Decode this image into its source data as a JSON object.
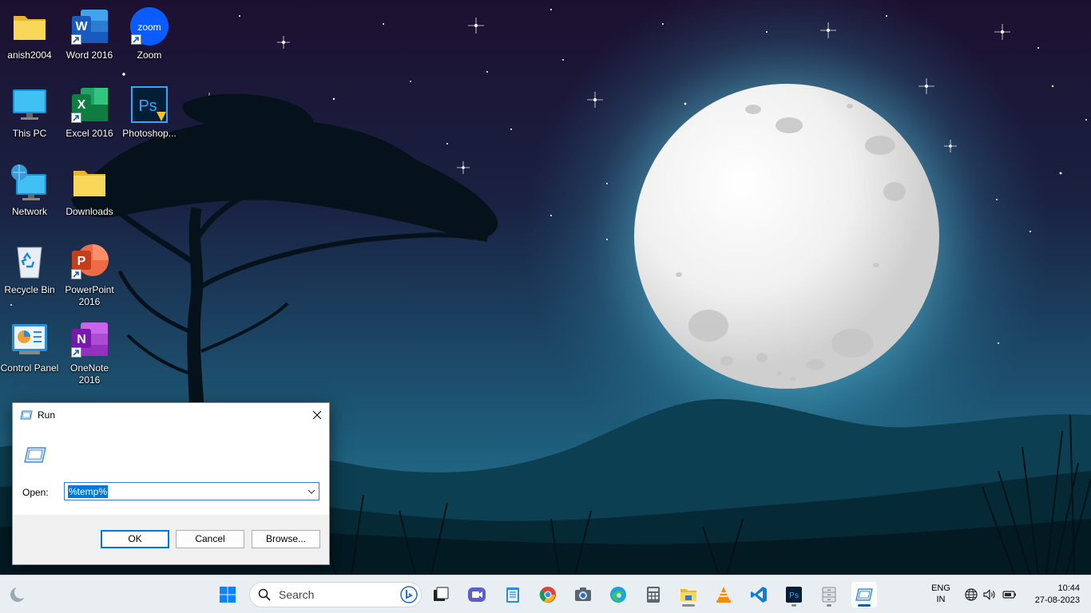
{
  "desktop": {
    "icons": [
      {
        "label": "anish2004"
      },
      {
        "label": "Word 2016"
      },
      {
        "label": "Zoom",
        "brand_text": "zoom"
      },
      {
        "label": "This PC"
      },
      {
        "label": "Excel 2016"
      },
      {
        "label": "Photoshop..."
      },
      {
        "label": "Network"
      },
      {
        "label": "Downloads"
      },
      {
        "label": "Recycle Bin"
      },
      {
        "label": "PowerPoint 2016"
      },
      {
        "label": "Control Panel"
      },
      {
        "label": "OneNote 2016"
      }
    ]
  },
  "run_dialog": {
    "title": "Run",
    "description": "",
    "open_label": "Open:",
    "open_value": "%temp%",
    "ok_label": "OK",
    "cancel_label": "Cancel",
    "browse_label": "Browse..."
  },
  "taskbar": {
    "search_label": "Search",
    "apps": [
      "start-icon",
      "task-view-icon",
      "meet-icon",
      "notepad-icon",
      "chrome-icon",
      "camera-icon",
      "edge-icon",
      "calculator-icon",
      "file-explorer-icon",
      "vlc-icon",
      "vscode-icon",
      "photoshop-icon",
      "file-cabinet-icon",
      "run-icon"
    ],
    "language": [
      "ENG",
      "IN"
    ],
    "time": "10:44",
    "date": "27-08-2023"
  },
  "colors": {
    "accent": "#0078d7",
    "taskbar_bg": "#e9eef3",
    "sky_top": "#1c1030",
    "sky_bottom": "#1f6a85"
  }
}
